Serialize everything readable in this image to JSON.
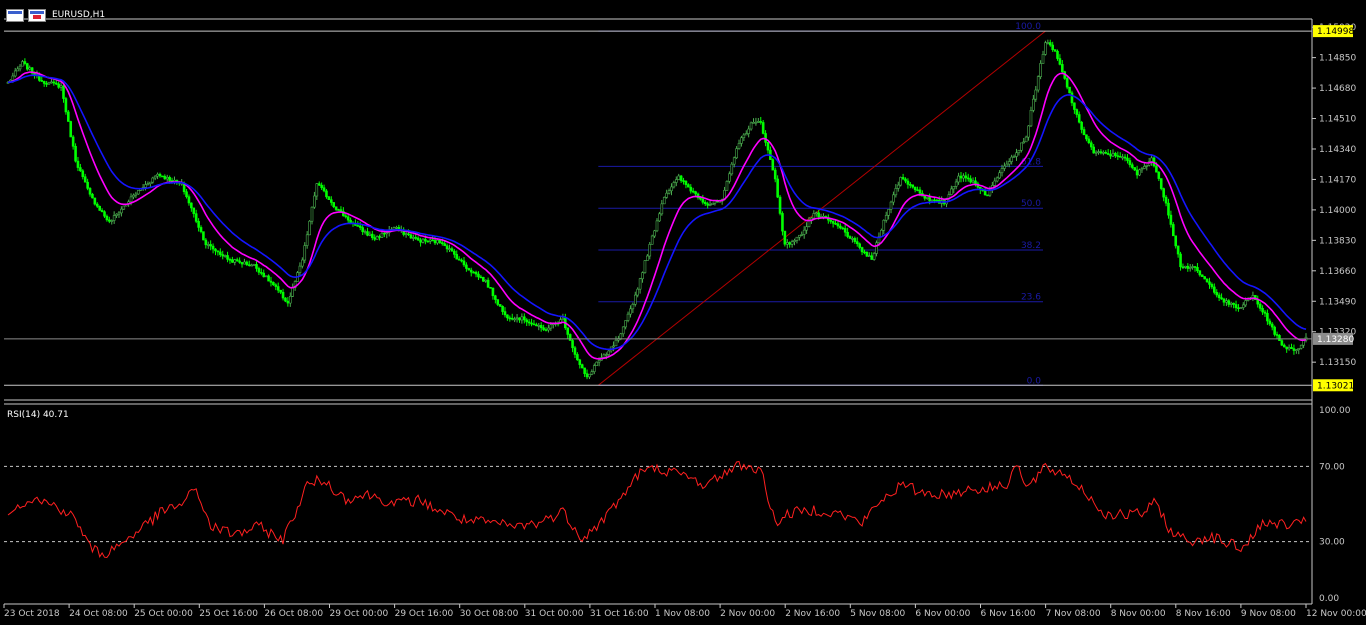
{
  "window": {
    "title": "EURUSD,H1"
  },
  "colors": {
    "background": "#000000",
    "bull_candle": "#4caf50",
    "bear_candle": "#00ff00",
    "ma_fast": "#ff00ff",
    "ma_slow": "#1515ff",
    "fib_lines": "#1a1aa6",
    "trendline": "#b40000",
    "rsi_line": "#ff2020",
    "level_label_bg": "#ffff00",
    "current_label_bg": "#8c8c8c",
    "axis_text": "#c8c8c8"
  },
  "price_axis": {
    "min": 1.1295,
    "max": 1.1506,
    "ticks": [
      "1.15020",
      "1.14850",
      "1.14680",
      "1.14510",
      "1.14340",
      "1.14170",
      "1.14000",
      "1.13830",
      "1.13660",
      "1.13490",
      "1.13320",
      "1.13150"
    ],
    "high_label": "1.14998",
    "low_label": "1.13021",
    "current_label": "1.13280"
  },
  "rsi": {
    "label": "RSI(14) 40.71",
    "ticks": [
      "100.00",
      "70.00",
      "30.00",
      "0.00"
    ],
    "levels": [
      70,
      30
    ]
  },
  "time_axis": [
    "23 Oct 2018",
    "24 Oct 08:00",
    "25 Oct 00:00",
    "25 Oct 16:00",
    "26 Oct 08:00",
    "29 Oct 00:00",
    "29 Oct 16:00",
    "30 Oct 08:00",
    "31 Oct 00:00",
    "31 Oct 16:00",
    "1 Nov 08:00",
    "2 Nov 00:00",
    "2 Nov 16:00",
    "5 Nov 08:00",
    "6 Nov 00:00",
    "6 Nov 16:00",
    "7 Nov 08:00",
    "8 Nov 00:00",
    "8 Nov 16:00",
    "9 Nov 08:00",
    "12 Nov 00:00"
  ],
  "fibonacci": {
    "high": 1.14998,
    "low": 1.13021,
    "levels": [
      {
        "ratio": 1.0,
        "label": "100.0"
      },
      {
        "ratio": 0.618,
        "label": "61.8"
      },
      {
        "ratio": 0.5,
        "label": "50.0"
      },
      {
        "ratio": 0.382,
        "label": "38.2"
      },
      {
        "ratio": 0.236,
        "label": "23.6"
      },
      {
        "ratio": 0.0,
        "label": "0.0"
      }
    ]
  },
  "chart_data": {
    "type": "candlestick",
    "symbol": "EURUSD",
    "timeframe": "H1",
    "close_anchors": [
      {
        "i": 0,
        "v": 1.1471
      },
      {
        "i": 6,
        "v": 1.1482
      },
      {
        "i": 14,
        "v": 1.1472
      },
      {
        "i": 22,
        "v": 1.1469
      },
      {
        "i": 28,
        "v": 1.1428
      },
      {
        "i": 34,
        "v": 1.1408
      },
      {
        "i": 42,
        "v": 1.1393
      },
      {
        "i": 52,
        "v": 1.1408
      },
      {
        "i": 62,
        "v": 1.142
      },
      {
        "i": 72,
        "v": 1.1414
      },
      {
        "i": 82,
        "v": 1.1381
      },
      {
        "i": 92,
        "v": 1.1372
      },
      {
        "i": 102,
        "v": 1.1369
      },
      {
        "i": 110,
        "v": 1.1358
      },
      {
        "i": 116,
        "v": 1.1348
      },
      {
        "i": 122,
        "v": 1.1372
      },
      {
        "i": 128,
        "v": 1.1415
      },
      {
        "i": 136,
        "v": 1.1401
      },
      {
        "i": 144,
        "v": 1.1391
      },
      {
        "i": 152,
        "v": 1.1384
      },
      {
        "i": 160,
        "v": 1.139
      },
      {
        "i": 170,
        "v": 1.1383
      },
      {
        "i": 180,
        "v": 1.1382
      },
      {
        "i": 190,
        "v": 1.1368
      },
      {
        "i": 198,
        "v": 1.136
      },
      {
        "i": 206,
        "v": 1.1341
      },
      {
        "i": 214,
        "v": 1.1339
      },
      {
        "i": 222,
        "v": 1.1333
      },
      {
        "i": 230,
        "v": 1.1339
      },
      {
        "i": 236,
        "v": 1.1316
      },
      {
        "i": 240,
        "v": 1.1306
      },
      {
        "i": 244,
        "v": 1.1315
      },
      {
        "i": 248,
        "v": 1.1319
      },
      {
        "i": 254,
        "v": 1.133
      },
      {
        "i": 260,
        "v": 1.1352
      },
      {
        "i": 266,
        "v": 1.138
      },
      {
        "i": 272,
        "v": 1.1408
      },
      {
        "i": 278,
        "v": 1.1418
      },
      {
        "i": 284,
        "v": 1.141
      },
      {
        "i": 290,
        "v": 1.1403
      },
      {
        "i": 296,
        "v": 1.1405
      },
      {
        "i": 302,
        "v": 1.1435
      },
      {
        "i": 308,
        "v": 1.1448
      },
      {
        "i": 312,
        "v": 1.1449
      },
      {
        "i": 318,
        "v": 1.1417
      },
      {
        "i": 322,
        "v": 1.138
      },
      {
        "i": 328,
        "v": 1.1385
      },
      {
        "i": 334,
        "v": 1.1398
      },
      {
        "i": 340,
        "v": 1.1394
      },
      {
        "i": 346,
        "v": 1.1389
      },
      {
        "i": 352,
        "v": 1.138
      },
      {
        "i": 358,
        "v": 1.1372
      },
      {
        "i": 364,
        "v": 1.1398
      },
      {
        "i": 370,
        "v": 1.1418
      },
      {
        "i": 376,
        "v": 1.1412
      },
      {
        "i": 382,
        "v": 1.1405
      },
      {
        "i": 388,
        "v": 1.1404
      },
      {
        "i": 394,
        "v": 1.1419
      },
      {
        "i": 400,
        "v": 1.1416
      },
      {
        "i": 406,
        "v": 1.1408
      },
      {
        "i": 412,
        "v": 1.1424
      },
      {
        "i": 418,
        "v": 1.1432
      },
      {
        "i": 422,
        "v": 1.1441
      },
      {
        "i": 426,
        "v": 1.1468
      },
      {
        "i": 430,
        "v": 1.1494
      },
      {
        "i": 434,
        "v": 1.1488
      },
      {
        "i": 438,
        "v": 1.1473
      },
      {
        "i": 444,
        "v": 1.1448
      },
      {
        "i": 450,
        "v": 1.1432
      },
      {
        "i": 456,
        "v": 1.1431
      },
      {
        "i": 462,
        "v": 1.143
      },
      {
        "i": 468,
        "v": 1.142
      },
      {
        "i": 474,
        "v": 1.1429
      },
      {
        "i": 480,
        "v": 1.1404
      },
      {
        "i": 486,
        "v": 1.1369
      },
      {
        "i": 492,
        "v": 1.1367
      },
      {
        "i": 498,
        "v": 1.1358
      },
      {
        "i": 504,
        "v": 1.1349
      },
      {
        "i": 510,
        "v": 1.1345
      },
      {
        "i": 516,
        "v": 1.1352
      },
      {
        "i": 522,
        "v": 1.1339
      },
      {
        "i": 528,
        "v": 1.1324
      },
      {
        "i": 534,
        "v": 1.1322
      },
      {
        "i": 538,
        "v": 1.1328
      }
    ],
    "rsi_anchors": [
      {
        "i": 0,
        "v": 47
      },
      {
        "i": 10,
        "v": 53
      },
      {
        "i": 20,
        "v": 49
      },
      {
        "i": 28,
        "v": 42
      },
      {
        "i": 34,
        "v": 27
      },
      {
        "i": 40,
        "v": 23
      },
      {
        "i": 48,
        "v": 30
      },
      {
        "i": 56,
        "v": 38
      },
      {
        "i": 64,
        "v": 46
      },
      {
        "i": 72,
        "v": 50
      },
      {
        "i": 78,
        "v": 58
      },
      {
        "i": 84,
        "v": 38
      },
      {
        "i": 94,
        "v": 34
      },
      {
        "i": 104,
        "v": 38
      },
      {
        "i": 114,
        "v": 31
      },
      {
        "i": 124,
        "v": 60
      },
      {
        "i": 130,
        "v": 63
      },
      {
        "i": 140,
        "v": 53
      },
      {
        "i": 150,
        "v": 55
      },
      {
        "i": 160,
        "v": 50
      },
      {
        "i": 170,
        "v": 52
      },
      {
        "i": 180,
        "v": 46
      },
      {
        "i": 190,
        "v": 41
      },
      {
        "i": 200,
        "v": 40
      },
      {
        "i": 210,
        "v": 38
      },
      {
        "i": 220,
        "v": 40
      },
      {
        "i": 230,
        "v": 46
      },
      {
        "i": 238,
        "v": 32
      },
      {
        "i": 244,
        "v": 38
      },
      {
        "i": 252,
        "v": 50
      },
      {
        "i": 262,
        "v": 67
      },
      {
        "i": 270,
        "v": 69
      },
      {
        "i": 280,
        "v": 65
      },
      {
        "i": 290,
        "v": 60
      },
      {
        "i": 296,
        "v": 66
      },
      {
        "i": 304,
        "v": 71
      },
      {
        "i": 312,
        "v": 68
      },
      {
        "i": 318,
        "v": 40
      },
      {
        "i": 324,
        "v": 45
      },
      {
        "i": 334,
        "v": 47
      },
      {
        "i": 344,
        "v": 45
      },
      {
        "i": 354,
        "v": 40
      },
      {
        "i": 362,
        "v": 52
      },
      {
        "i": 370,
        "v": 60
      },
      {
        "i": 380,
        "v": 56
      },
      {
        "i": 390,
        "v": 55
      },
      {
        "i": 398,
        "v": 58
      },
      {
        "i": 406,
        "v": 58
      },
      {
        "i": 414,
        "v": 61
      },
      {
        "i": 418,
        "v": 72
      },
      {
        "i": 422,
        "v": 58
      },
      {
        "i": 430,
        "v": 69
      },
      {
        "i": 438,
        "v": 66
      },
      {
        "i": 446,
        "v": 57
      },
      {
        "i": 454,
        "v": 45
      },
      {
        "i": 462,
        "v": 44
      },
      {
        "i": 470,
        "v": 45
      },
      {
        "i": 476,
        "v": 51
      },
      {
        "i": 482,
        "v": 35
      },
      {
        "i": 490,
        "v": 30
      },
      {
        "i": 498,
        "v": 33
      },
      {
        "i": 506,
        "v": 29
      },
      {
        "i": 512,
        "v": 26
      },
      {
        "i": 518,
        "v": 38
      },
      {
        "i": 526,
        "v": 40
      },
      {
        "i": 532,
        "v": 38
      },
      {
        "i": 538,
        "v": 40.71
      }
    ]
  }
}
